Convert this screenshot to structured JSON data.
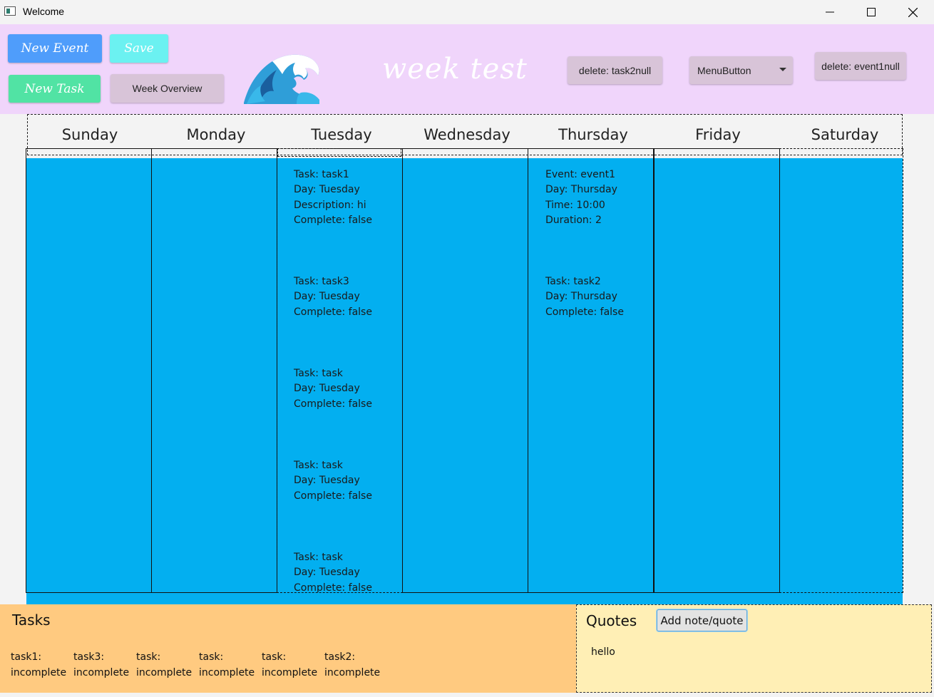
{
  "window": {
    "title": "Welcome",
    "controls": [
      "minimize-icon",
      "maximize-icon",
      "close-icon"
    ]
  },
  "toolbar": {
    "new_event": "New Event",
    "save": "Save",
    "new_task": "New Task",
    "week_overview": "Week Overview",
    "delete_task": "delete: task2null",
    "menu_button": "MenuButton",
    "delete_event": "delete: event1null",
    "logo_icon": "wave-icon",
    "colors": {
      "header_bg": "#f0d5fb",
      "new_event_bg": "#4f9dfb",
      "save_bg": "#6bf1f1",
      "new_task_bg": "#51e3a4",
      "plain_btn_bg": "#d8c4d8"
    }
  },
  "week": {
    "title": "week test",
    "days": [
      "Sunday",
      "Monday",
      "Tuesday",
      "Wednesday",
      "Thursday",
      "Friday",
      "Saturday"
    ],
    "column_color": "#03aff0",
    "tuesday_entries": [
      [
        "Task: task1",
        "Day: Tuesday",
        "Description: hi",
        "Complete: false"
      ],
      [
        "Task: task3",
        "Day: Tuesday",
        "Complete: false"
      ],
      [
        "Task: task",
        "Day: Tuesday",
        "Complete: false"
      ],
      [
        "Task: task",
        "Day: Tuesday",
        "Complete: false"
      ],
      [
        "Task: task",
        "Day: Tuesday",
        "Complete: false"
      ]
    ],
    "thursday_entries": [
      [
        "Event: event1",
        "Day: Thursday",
        "Time: 10:00",
        "Duration: 2"
      ],
      [
        "Task: task2",
        "Day: Thursday",
        "Complete: false"
      ]
    ]
  },
  "tasks_panel": {
    "title": "Tasks",
    "items": [
      {
        "name": "task1:",
        "status": "incomplete"
      },
      {
        "name": "task3:",
        "status": "incomplete"
      },
      {
        "name": "task:",
        "status": "incomplete"
      },
      {
        "name": "task:",
        "status": "incomplete"
      },
      {
        "name": "task:",
        "status": "incomplete"
      },
      {
        "name": "task2:",
        "status": "incomplete"
      }
    ]
  },
  "quotes_panel": {
    "title": "Quotes",
    "add_button": "Add note/quote",
    "note": "hello"
  }
}
